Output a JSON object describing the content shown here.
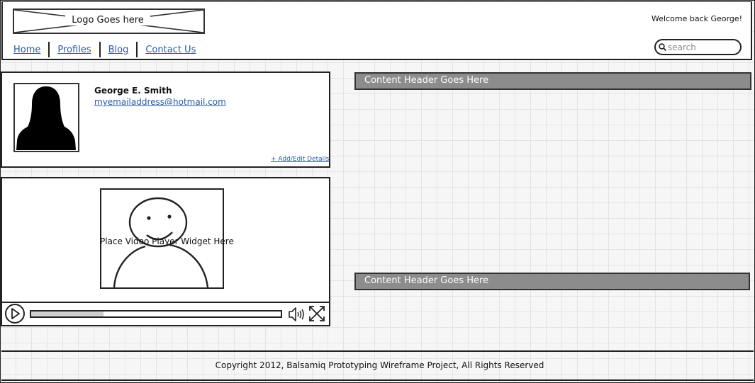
{
  "header": {
    "logo_text": "Logo Goes here",
    "welcome": "Welcome back George!",
    "search_placeholder": "search",
    "nav": [
      "Home",
      "Profiles",
      "Blog",
      "Contact Us"
    ]
  },
  "profile": {
    "name": "George E. Smith",
    "email": "myemailaddress@hotmail.com",
    "add_edit": "+ Add/Edit Details"
  },
  "video": {
    "label": "Place Video Player Widget Here",
    "progress": 0.29
  },
  "content": {
    "header1": "Content Header Goes Here",
    "header2": "Content Header Goes Here"
  },
  "footer": {
    "copyright": "Copyright 2012, Balsamiq Prototyping Wireframe Project, All Rights Reserved"
  }
}
